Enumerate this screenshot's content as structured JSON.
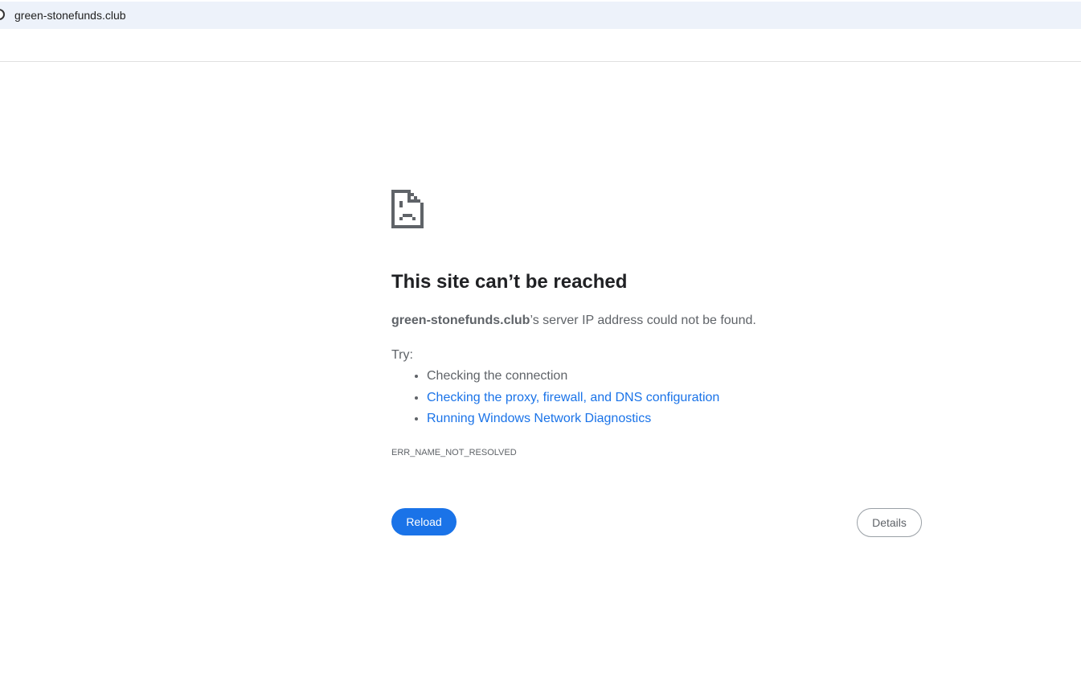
{
  "browser": {
    "url": "green-stonefunds.club"
  },
  "error": {
    "title": "This site can’t be reached",
    "host": "green-stonefunds.club",
    "summary_rest": "’s server IP address could not be found.",
    "try_label": "Try:",
    "suggestions": [
      {
        "text": "Checking the connection"
      },
      {
        "text": "Checking the proxy, firewall, and DNS configuration"
      },
      {
        "text": "Running Windows Network Diagnostics"
      }
    ],
    "code": "ERR_NAME_NOT_RESOLVED",
    "reload_label": "Reload",
    "details_label": "Details"
  }
}
